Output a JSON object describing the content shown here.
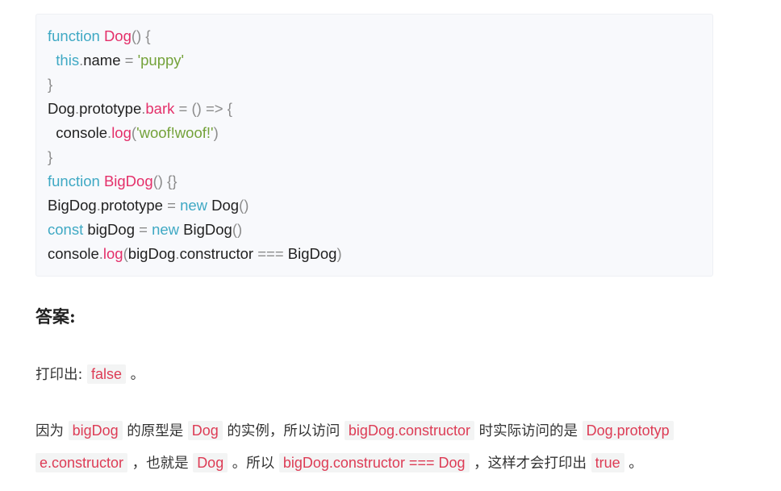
{
  "code_lines": [
    [
      {
        "c": "kw",
        "t": "function"
      },
      {
        "c": "tx",
        "t": " "
      },
      {
        "c": "fn",
        "t": "Dog"
      },
      {
        "c": "pn",
        "t": "()"
      },
      {
        "c": "tx",
        "t": " "
      },
      {
        "c": "pn",
        "t": "{"
      }
    ],
    [
      {
        "c": "tx",
        "t": "  "
      },
      {
        "c": "kw",
        "t": "this"
      },
      {
        "c": "pn",
        "t": "."
      },
      {
        "c": "tx",
        "t": "name "
      },
      {
        "c": "pn",
        "t": "="
      },
      {
        "c": "tx",
        "t": " "
      },
      {
        "c": "str",
        "t": "'puppy'"
      }
    ],
    [
      {
        "c": "pn",
        "t": "}"
      }
    ],
    [
      {
        "c": "tx",
        "t": "Dog"
      },
      {
        "c": "pn",
        "t": "."
      },
      {
        "c": "tx",
        "t": "prototype"
      },
      {
        "c": "pn",
        "t": "."
      },
      {
        "c": "fn",
        "t": "bark"
      },
      {
        "c": "tx",
        "t": " "
      },
      {
        "c": "pn",
        "t": "="
      },
      {
        "c": "tx",
        "t": " "
      },
      {
        "c": "pn",
        "t": "()"
      },
      {
        "c": "tx",
        "t": " "
      },
      {
        "c": "pn",
        "t": "=>"
      },
      {
        "c": "tx",
        "t": " "
      },
      {
        "c": "pn",
        "t": "{"
      }
    ],
    [
      {
        "c": "tx",
        "t": "  console"
      },
      {
        "c": "pn",
        "t": "."
      },
      {
        "c": "fn",
        "t": "log"
      },
      {
        "c": "pn",
        "t": "("
      },
      {
        "c": "str",
        "t": "'woof!woof!'"
      },
      {
        "c": "pn",
        "t": ")"
      }
    ],
    [
      {
        "c": "pn",
        "t": "}"
      }
    ],
    [
      {
        "c": "kw",
        "t": "function"
      },
      {
        "c": "tx",
        "t": " "
      },
      {
        "c": "fn",
        "t": "BigDog"
      },
      {
        "c": "pn",
        "t": "()"
      },
      {
        "c": "tx",
        "t": " "
      },
      {
        "c": "pn",
        "t": "{}"
      }
    ],
    [
      {
        "c": "tx",
        "t": "BigDog"
      },
      {
        "c": "pn",
        "t": "."
      },
      {
        "c": "tx",
        "t": "prototype "
      },
      {
        "c": "pn",
        "t": "="
      },
      {
        "c": "tx",
        "t": " "
      },
      {
        "c": "kw",
        "t": "new"
      },
      {
        "c": "tx",
        "t": " Dog"
      },
      {
        "c": "pn",
        "t": "()"
      }
    ],
    [
      {
        "c": "kw",
        "t": "const"
      },
      {
        "c": "tx",
        "t": " bigDog "
      },
      {
        "c": "pn",
        "t": "="
      },
      {
        "c": "tx",
        "t": " "
      },
      {
        "c": "kw",
        "t": "new"
      },
      {
        "c": "tx",
        "t": " BigDog"
      },
      {
        "c": "pn",
        "t": "()"
      }
    ],
    [
      {
        "c": "tx",
        "t": "console"
      },
      {
        "c": "pn",
        "t": "."
      },
      {
        "c": "fn",
        "t": "log"
      },
      {
        "c": "pn",
        "t": "("
      },
      {
        "c": "tx",
        "t": "bigDog"
      },
      {
        "c": "pn",
        "t": "."
      },
      {
        "c": "tx",
        "t": "constructor "
      },
      {
        "c": "pn",
        "t": "==="
      },
      {
        "c": "tx",
        "t": " BigDog"
      },
      {
        "c": "pn",
        "t": ")"
      }
    ]
  ],
  "heading": "答案:",
  "para1": [
    {
      "k": "text",
      "t": "打印出: "
    },
    {
      "k": "code",
      "t": "false"
    },
    {
      "k": "text",
      "t": " 。"
    }
  ],
  "para2_line1": [
    {
      "k": "text",
      "t": "因为 "
    },
    {
      "k": "code",
      "t": "bigDog"
    },
    {
      "k": "text",
      "t": " 的原型是 "
    },
    {
      "k": "code",
      "t": "Dog"
    },
    {
      "k": "text",
      "t": " 的实例，所以访问 "
    },
    {
      "k": "code",
      "t": "bigDog.constructor"
    },
    {
      "k": "text",
      "t": " 时实际访问的是 "
    },
    {
      "k": "code",
      "t": "Dog.prototyp"
    }
  ],
  "para2_line2": [
    {
      "k": "code",
      "t": "e.constructor"
    },
    {
      "k": "text",
      "t": " ，也就是 "
    },
    {
      "k": "code",
      "t": "Dog"
    },
    {
      "k": "text",
      "t": " 。所以 "
    },
    {
      "k": "code",
      "t": "bigDog.constructor === Dog"
    },
    {
      "k": "text",
      "t": " ，这样才会打印出 "
    },
    {
      "k": "code",
      "t": "true"
    },
    {
      "k": "text",
      "t": " 。"
    }
  ],
  "colors": {
    "keyword": "#3fa9c4",
    "function_name": "#e4306a",
    "string": "#74a23a",
    "punctuation": "#8c8c8c",
    "inline_code_text": "#dd3c55",
    "inline_code_bg": "#f3f4f4",
    "code_block_bg": "#f8f9fc"
  }
}
